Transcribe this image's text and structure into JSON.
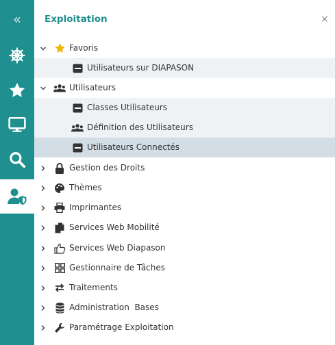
{
  "panel": {
    "title": "Exploitation",
    "close_glyph": "×"
  },
  "rail": {
    "items": [
      {
        "icon": "double-chevron-left-icon",
        "glyph": "«"
      },
      {
        "icon": "helm-wheel-icon"
      },
      {
        "icon": "star-icon"
      },
      {
        "icon": "monitor-icon"
      },
      {
        "icon": "search-icon"
      },
      {
        "icon": "user-shield-icon",
        "active": true
      }
    ]
  },
  "tree": [
    {
      "label": "Favoris",
      "icon": "star-icon",
      "expanded": true
    },
    {
      "label": "Utilisateurs sur DIAPASON",
      "icon": "window-icon"
    },
    {
      "label": "Utilisateurs",
      "icon": "users-icon",
      "expanded": true
    },
    {
      "label": "Classes Utilisateurs",
      "icon": "window-icon"
    },
    {
      "label": "Définition des Utilisateurs",
      "icon": "users-icon"
    },
    {
      "label": "Utilisateurs Connectés",
      "icon": "window-icon",
      "selected": true
    },
    {
      "label": "Gestion des Droits",
      "icon": "lock-icon"
    },
    {
      "label": "Thèmes",
      "icon": "palette-icon"
    },
    {
      "label": "Imprimantes",
      "icon": "printer-icon"
    },
    {
      "label": "Services Web Mobilité",
      "icon": "documents-icon"
    },
    {
      "label": "Services Web Diapason",
      "icon": "thumbs-up-icon"
    },
    {
      "label": "Gestionnaire de Tâches",
      "icon": "grid-icon"
    },
    {
      "label": "Traitements",
      "icon": "sync-arrows-icon"
    },
    {
      "label": "Administration  Bases",
      "icon": "database-icon"
    },
    {
      "label": "Paramétrage Exploitation",
      "icon": "wrench-icon"
    }
  ],
  "colors": {
    "accent": "#1f8f8f",
    "star": "#f5b400",
    "selected_bg": "#d3dde5",
    "child_bg": "#eef2f5"
  }
}
